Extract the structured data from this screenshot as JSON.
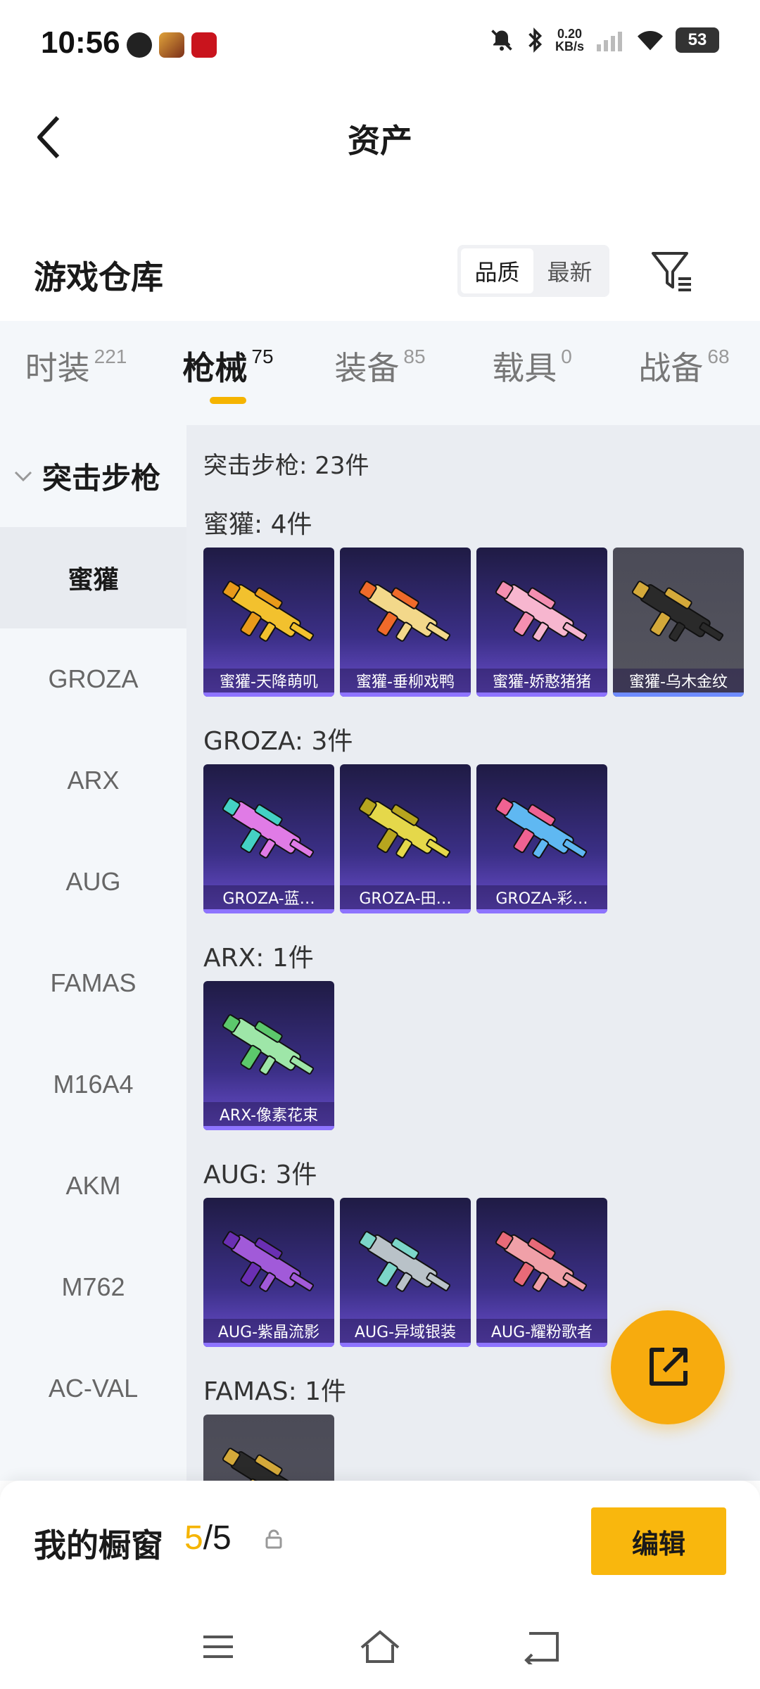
{
  "status_bar": {
    "time": "10:56",
    "net_speed_value": "0.20",
    "net_speed_unit": "KB/s",
    "battery": "53"
  },
  "header": {
    "title": "资产"
  },
  "warehouse": {
    "title": "游戏仓库",
    "sort_options": [
      "品质",
      "最新"
    ],
    "sort_selected": "品质"
  },
  "tabs": [
    {
      "label": "时装",
      "count": "221"
    },
    {
      "label": "枪械",
      "count": "75"
    },
    {
      "label": "装备",
      "count": "85"
    },
    {
      "label": "载具",
      "count": "0"
    },
    {
      "label": "战备",
      "count": "68"
    }
  ],
  "active_tab": "枪械",
  "sidebar": {
    "group_label": "突击步枪",
    "items": [
      "蜜獾",
      "GROZA",
      "ARX",
      "AUG",
      "FAMAS",
      "M16A4",
      "AKM",
      "M762",
      "AC-VAL"
    ],
    "active_item": "蜜獾"
  },
  "content": {
    "summary": "突击步枪: 23件",
    "sections": [
      {
        "title": "蜜獾: 4件",
        "items": [
          {
            "label": "蜜獾-天降萌叽",
            "gun_color": "#f2c12e",
            "accent": "#e89a1a",
            "style": "purple"
          },
          {
            "label": "蜜獾-垂柳戏鸭",
            "gun_color": "#f3d88a",
            "accent": "#ef6a2a",
            "style": "purple"
          },
          {
            "label": "蜜獾-娇憨猪猪",
            "gun_color": "#f7b6cf",
            "accent": "#f48fb1",
            "style": "purple"
          },
          {
            "label": "蜜獾-乌木金纹",
            "gun_color": "#2a2a2a",
            "accent": "#d4a93a",
            "style": "dark"
          }
        ]
      },
      {
        "title": "GROZA: 3件",
        "items": [
          {
            "label": "GROZA-蓝…",
            "gun_color": "#e07be6",
            "accent": "#44d1c4",
            "style": "purple"
          },
          {
            "label": "GROZA-田…",
            "gun_color": "#e5d84a",
            "accent": "#b7a51e",
            "style": "purple"
          },
          {
            "label": "GROZA-彩…",
            "gun_color": "#5fb8f2",
            "accent": "#f06292",
            "style": "purple"
          }
        ]
      },
      {
        "title": "ARX: 1件",
        "items": [
          {
            "label": "ARX-像素花束",
            "gun_color": "#9ee6a8",
            "accent": "#5cc86c",
            "style": "purple"
          }
        ]
      },
      {
        "title": "AUG: 3件",
        "items": [
          {
            "label": "AUG-紫晶流影",
            "gun_color": "#a15ad9",
            "accent": "#6a2fb3",
            "style": "purple"
          },
          {
            "label": "AUG-异域银装",
            "gun_color": "#b9c2c8",
            "accent": "#7cd6c9",
            "style": "purple"
          },
          {
            "label": "AUG-耀粉歌者",
            "gun_color": "#f0a0a8",
            "accent": "#e86a78",
            "style": "purple"
          }
        ]
      },
      {
        "title": "FAMAS: 1件",
        "items": [
          {
            "label": "",
            "gun_color": "#2a2a2a",
            "accent": "#d4a93a",
            "style": "dark"
          }
        ]
      }
    ]
  },
  "showcase": {
    "label": "我的橱窗",
    "current": "5",
    "separator": "/",
    "total": "5",
    "edit_label": "编辑"
  },
  "colors": {
    "accent": "#f5b400",
    "fab": "#f7ab0e",
    "card_purple": "#3b2f86"
  }
}
